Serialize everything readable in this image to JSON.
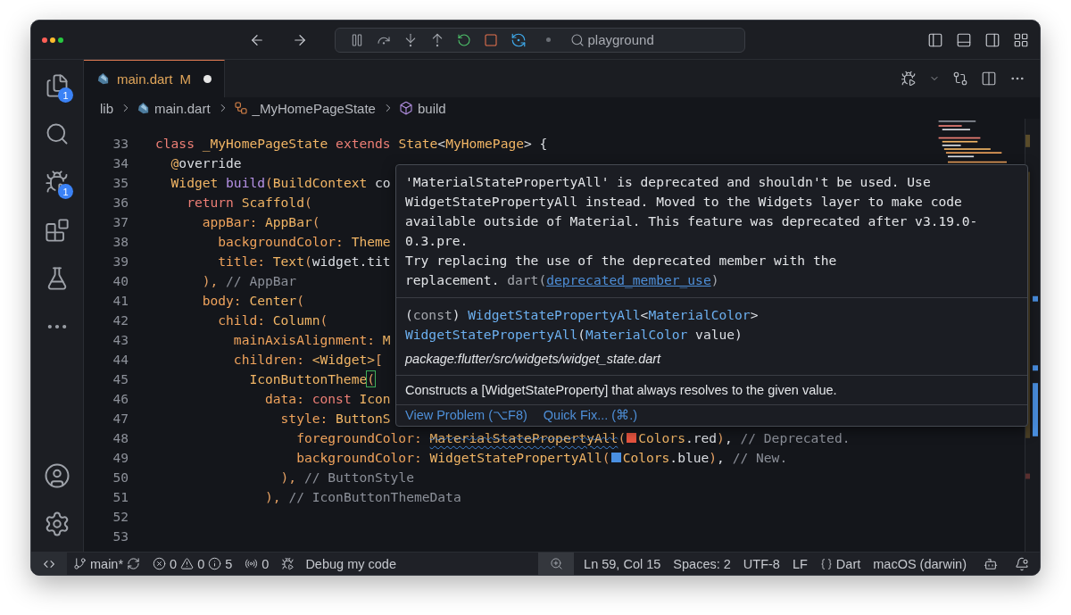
{
  "title_bar": {
    "search": "playground"
  },
  "activity_bar": {
    "items": [
      {
        "kind": "files",
        "badge": "1"
      },
      {
        "kind": "search"
      },
      {
        "kind": "debug",
        "badge": "1"
      },
      {
        "kind": "extensions"
      },
      {
        "kind": "testing"
      },
      {
        "kind": "more"
      }
    ],
    "bottom": [
      {
        "kind": "account"
      },
      {
        "kind": "settings"
      }
    ]
  },
  "tabs": [
    {
      "label": "main.dart",
      "status": "M",
      "dirty": true,
      "selected": true
    }
  ],
  "breadcrumbs": [
    {
      "kind": "folder",
      "label": "lib"
    },
    {
      "kind": "file",
      "label": "main.dart"
    },
    {
      "kind": "class",
      "label": "_MyHomePageState"
    },
    {
      "kind": "method",
      "label": "build"
    }
  ],
  "editor": {
    "lines": [
      {
        "number": "33",
        "tokens": [
          {
            "kind": "keyword",
            "text": "class "
          },
          {
            "kind": "type",
            "text": "_MyHomePageState "
          },
          {
            "kind": "keyword",
            "text": "extends "
          },
          {
            "kind": "type",
            "text": "State"
          },
          {
            "kind": "plain",
            "text": "<"
          },
          {
            "kind": "type",
            "text": "MyHomePage"
          },
          {
            "kind": "plain",
            "text": "> {"
          }
        ]
      },
      {
        "number": "34",
        "tokens": [
          {
            "kind": "type",
            "text": "  @"
          },
          {
            "kind": "plain",
            "text": "override"
          }
        ]
      },
      {
        "number": "35",
        "tokens": [
          {
            "kind": "type",
            "text": "  Widget "
          },
          {
            "kind": "func",
            "text": "build"
          },
          {
            "kind": "bracket",
            "text": "("
          },
          {
            "kind": "type",
            "text": "BuildContext "
          },
          {
            "kind": "plain",
            "text": "co"
          }
        ]
      },
      {
        "number": "36",
        "tokens": [
          {
            "kind": "keyword",
            "text": "    return "
          },
          {
            "kind": "type",
            "text": "Scaffold"
          },
          {
            "kind": "bracket",
            "text": "("
          }
        ]
      },
      {
        "number": "37",
        "tokens": [
          {
            "kind": "prop",
            "text": "      appBar: "
          },
          {
            "kind": "type",
            "text": "AppBar"
          },
          {
            "kind": "bracket",
            "text": "("
          }
        ]
      },
      {
        "number": "38",
        "tokens": [
          {
            "kind": "prop",
            "text": "        backgroundColor: "
          },
          {
            "kind": "type",
            "text": "Theme"
          }
        ]
      },
      {
        "number": "39",
        "tokens": [
          {
            "kind": "prop",
            "text": "        title: "
          },
          {
            "kind": "type",
            "text": "Text"
          },
          {
            "kind": "bracket",
            "text": "("
          },
          {
            "kind": "plain",
            "text": "widget.tit"
          }
        ]
      },
      {
        "number": "40",
        "tokens": [
          {
            "kind": "bracket",
            "text": "      ),"
          },
          {
            "kind": "comment",
            "text": " // AppBar"
          }
        ]
      },
      {
        "number": "41",
        "tokens": [
          {
            "kind": "prop",
            "text": "      body: "
          },
          {
            "kind": "type",
            "text": "Center"
          },
          {
            "kind": "bracket",
            "text": "("
          }
        ]
      },
      {
        "number": "42",
        "tokens": [
          {
            "kind": "prop",
            "text": "        child: "
          },
          {
            "kind": "type",
            "text": "Column"
          },
          {
            "kind": "bracket",
            "text": "("
          }
        ]
      },
      {
        "number": "43",
        "tokens": [
          {
            "kind": "prop",
            "text": "          mainAxisAlignment: "
          },
          {
            "kind": "type",
            "text": "M"
          }
        ]
      },
      {
        "number": "44",
        "tokens": [
          {
            "kind": "prop",
            "text": "          children: "
          },
          {
            "kind": "type",
            "text": "<Widget>"
          },
          {
            "kind": "bracket",
            "text": "["
          }
        ]
      },
      {
        "number": "45",
        "tokens": [
          {
            "kind": "type",
            "text": "            IconButtonTheme"
          },
          {
            "kind": "match",
            "text": "("
          }
        ]
      },
      {
        "number": "46",
        "tokens": [
          {
            "kind": "prop",
            "text": "              data: "
          },
          {
            "kind": "keyword",
            "text": "const "
          },
          {
            "kind": "type",
            "text": "Icon"
          }
        ]
      },
      {
        "number": "47",
        "tokens": [
          {
            "kind": "prop",
            "text": "                style: "
          },
          {
            "kind": "type",
            "text": "ButtonS"
          }
        ]
      },
      {
        "number": "48",
        "tokens": [
          {
            "kind": "prop",
            "text": "                  foregroundColor: "
          },
          {
            "kind": "deprecated",
            "text": "MaterialStatePropertyAll"
          },
          {
            "kind": "bracket",
            "text": "("
          },
          {
            "kind": "swatch",
            "color": "#e5533f"
          },
          {
            "kind": "type",
            "text": "Colors"
          },
          {
            "kind": "plain",
            "text": ".red"
          },
          {
            "kind": "bracket",
            "text": ")"
          },
          {
            "kind": "plain",
            "text": ","
          },
          {
            "kind": "comment",
            "text": " // Deprecated."
          }
        ]
      },
      {
        "number": "49",
        "tokens": [
          {
            "kind": "prop",
            "text": "                  backgroundColor: "
          },
          {
            "kind": "type",
            "text": "WidgetStatePropertyAll"
          },
          {
            "kind": "bracket",
            "text": "("
          },
          {
            "kind": "swatch",
            "color": "#4a90e2"
          },
          {
            "kind": "type",
            "text": "Colors"
          },
          {
            "kind": "plain",
            "text": ".blue"
          },
          {
            "kind": "bracket",
            "text": ")"
          },
          {
            "kind": "plain",
            "text": ","
          },
          {
            "kind": "comment",
            "text": " // New."
          }
        ]
      },
      {
        "number": "50",
        "tokens": [
          {
            "kind": "bracket",
            "text": "                ),"
          },
          {
            "kind": "comment",
            "text": " // ButtonStyle"
          }
        ]
      },
      {
        "number": "51",
        "tokens": [
          {
            "kind": "bracket",
            "text": "              ),"
          },
          {
            "kind": "comment",
            "text": " // IconButtonThemeData"
          }
        ]
      },
      {
        "number": "52"
      },
      {
        "number": "53"
      }
    ]
  },
  "hover": {
    "message": "'MaterialStatePropertyAll' is deprecated and shouldn't be used. Use\nWidgetStatePropertyAll instead. Moved to the Widgets layer to make code\navailable outside of Material. This feature was deprecated after v3.19.0-\n0.3.pre.\nTry replacing the use of the deprecated member with the\nreplacement. ",
    "source": "dart(",
    "code": "deprecated_member_use",
    "close": ")",
    "signature": [
      [
        {
          "kind": "plain",
          "text": "("
        },
        {
          "kind": "muted",
          "text": "const"
        },
        {
          "kind": "plain",
          "text": ") "
        },
        {
          "kind": "sigtype",
          "text": "WidgetStatePropertyAll"
        },
        {
          "kind": "plain",
          "text": "<"
        },
        {
          "kind": "sigtype",
          "text": "MaterialColor"
        },
        {
          "kind": "plain",
          "text": ">"
        }
      ],
      [
        {
          "kind": "sigtype",
          "text": "WidgetStatePropertyAll"
        },
        {
          "kind": "plain",
          "text": "("
        },
        {
          "kind": "sigtype",
          "text": "MaterialColor"
        },
        {
          "kind": "plain",
          "text": " value)"
        }
      ]
    ],
    "path": "package:flutter/src/widgets/widget_state.dart",
    "doc": "Constructs a [WidgetStateProperty] that always resolves to the given value.",
    "actions": [
      "View Problem (⌥F8)",
      "Quick Fix... (⌘.)"
    ]
  },
  "status_bar": {
    "branch": "main*",
    "errors": "0",
    "warnings": "0",
    "infos": "5",
    "ports": "0",
    "debug": "Debug my code",
    "position": "Ln 59, Col 15",
    "indent": "Spaces: 2",
    "encoding": "UTF-8",
    "eol": "LF",
    "language": "Dart",
    "platform": "macOS (darwin)"
  }
}
